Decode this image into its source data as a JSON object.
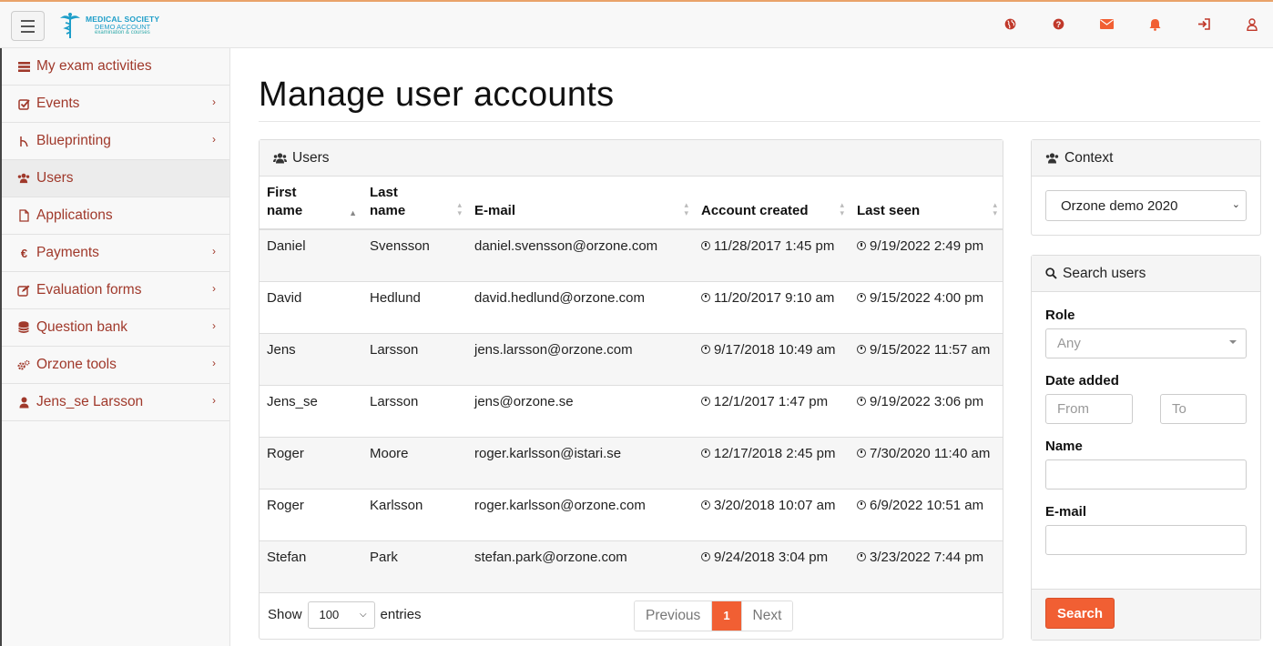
{
  "brand": {
    "line1": "MEDICAL SOCIETY",
    "line2": "DEMO ACCOUNT",
    "line3": "examination & courses"
  },
  "topbar_icons": [
    "globe-icon",
    "help-icon",
    "envelope-icon",
    "bell-icon",
    "sign-in-icon",
    "user-icon"
  ],
  "sidebar": {
    "items": [
      {
        "label": "My exam activities",
        "icon": "list-icon",
        "has_sub": false
      },
      {
        "label": "Events",
        "icon": "check-square-icon",
        "has_sub": true
      },
      {
        "label": "Blueprinting",
        "icon": "sitemap-icon",
        "has_sub": true
      },
      {
        "label": "Users",
        "icon": "users-icon",
        "has_sub": false
      },
      {
        "label": "Applications",
        "icon": "file-icon",
        "has_sub": false
      },
      {
        "label": "Payments",
        "icon": "euro-icon",
        "has_sub": true
      },
      {
        "label": "Evaluation forms",
        "icon": "edit-icon",
        "has_sub": true
      },
      {
        "label": "Question bank",
        "icon": "database-icon",
        "has_sub": true
      },
      {
        "label": "Orzone tools",
        "icon": "cogs-icon",
        "has_sub": true
      },
      {
        "label": "Jens_se Larsson",
        "icon": "user-icon",
        "has_sub": true
      }
    ]
  },
  "page": {
    "title": "Manage user accounts"
  },
  "users_panel": {
    "title": "Users",
    "columns": [
      "First name",
      "Last name",
      "E-mail",
      "Account created",
      "Last seen"
    ],
    "rows": [
      [
        "Daniel",
        "Svensson",
        "daniel.svensson@orzone.com",
        "11/28/2017 1:45 pm",
        "9/19/2022 2:49 pm"
      ],
      [
        "David",
        "Hedlund",
        "david.hedlund@orzone.com",
        "11/20/2017 9:10 am",
        "9/15/2022 4:00 pm"
      ],
      [
        "Jens",
        "Larsson",
        "jens.larsson@orzone.com",
        "9/17/2018 10:49 am",
        "9/15/2022 11:57 am"
      ],
      [
        "Jens_se",
        "Larsson",
        "jens@orzone.se",
        "12/1/2017 1:47 pm",
        "9/19/2022 3:06 pm"
      ],
      [
        "Roger",
        "Moore",
        "roger.karlsson@istari.se",
        "12/17/2018 2:45 pm",
        "7/30/2020 11:40 am"
      ],
      [
        "Roger",
        "Karlsson",
        "roger.karlsson@orzone.com",
        "3/20/2018 10:07 am",
        "6/9/2022 10:51 am"
      ],
      [
        "Stefan",
        "Park",
        "stefan.park@orzone.com",
        "9/24/2018 3:04 pm",
        "3/23/2022 7:44 pm"
      ]
    ],
    "footer": {
      "show_label": "Show",
      "entries_value": "100",
      "entries_label": "entries",
      "prev_label": "Previous",
      "page": "1",
      "next_label": "Next"
    }
  },
  "context_panel": {
    "title": "Context",
    "selected": "Orzone demo 2020"
  },
  "search_panel": {
    "title": "Search users",
    "role_label": "Role",
    "role_value": "Any",
    "date_label": "Date added",
    "from_placeholder": "From",
    "to_placeholder": "To",
    "name_label": "Name",
    "email_label": "E-mail",
    "search_button": "Search"
  },
  "colors": {
    "accent": "#f15f33",
    "link": "#a0392b",
    "icon_red": "#c0392b"
  }
}
